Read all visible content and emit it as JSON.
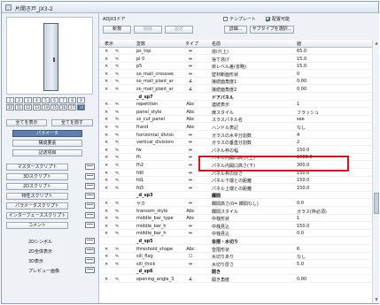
{
  "window": {
    "title": "片開き戸_JX3-2"
  },
  "left": {
    "view_rows": [
      [
        "1",
        "2",
        "3",
        "4",
        "5",
        "6",
        "7",
        "8",
        "9"
      ],
      [
        "10",
        "11",
        "12",
        "13",
        "14",
        "15",
        "16",
        "17",
        "18"
      ]
    ],
    "show_all": "全てを表示",
    "hide_all": "全てを隠す",
    "nav": [
      "パラメータ",
      "構成要素",
      "記述項目"
    ],
    "scripts": [
      "マスタースクリプト",
      "3Dスクリプト",
      "2Dスクリプト",
      "特性スクリプト",
      "パラメータスクリプト",
      "インターフェーススクリプト",
      "コメント"
    ],
    "views": [
      "2Dシンボル",
      "2D全体表示",
      "3D表示",
      "プレビュー画像"
    ]
  },
  "top": {
    "library_name": "ADJX3ドア",
    "template_label": "テンプレート",
    "placeable_label": "配置可能",
    "buttons": {
      "new": "新規",
      "delete": "削除",
      "settings": "設定",
      "details": "詳細...",
      "subtype": "サブタイプを選択..."
    }
  },
  "table": {
    "headers": {
      "show": "表示",
      "variable": "変数",
      "type": "タイプ",
      "name": "名前",
      "value": "値"
    },
    "rows": [
      {
        "var": "ps_top",
        "type": "⇹",
        "name": "逃げ(上)",
        "value": "65.0"
      },
      {
        "var": "pl 0",
        "type": "⇹",
        "name": "捨て逃げ",
        "value": "15.0"
      },
      {
        "var": "p5",
        "type": "⇹",
        "name": "床レベル差(省略)",
        "value": "15.0"
      },
      {
        "var": "so_mall_crosssection",
        "type": "⇹",
        "name": "壁材断面形状",
        "value": "0"
      },
      {
        "var": "so_mall_plant_angle1",
        "type": "∡",
        "name": "接続面角度1",
        "value": "0.00"
      },
      {
        "var": "so_mall_plant_angle2",
        "type": "∡",
        "name": "接続面角度2",
        "value": "0.00"
      },
      {
        "var": "_d_sp7",
        "type": "",
        "name": "ドアパネル",
        "value": "",
        "section": true
      },
      {
        "var": "repetition",
        "type": "Abc",
        "name": "連続表示",
        "value": "1"
      },
      {
        "var": "panel_style",
        "type": "Abc",
        "name": "扉スタイル",
        "value": "フラッシュ"
      },
      {
        "var": "ss_cut_panel",
        "type": "Abc",
        "name": "スラスパネル名",
        "value": "see"
      },
      {
        "var": "frand",
        "type": "Abc",
        "name": "ハンドル表記",
        "value": "なし"
      },
      {
        "var": "horizontal_divisions",
        "type": "⇹",
        "name": "ガラスの水平分割数",
        "value": "4"
      },
      {
        "var": "vertical_divisions",
        "type": "⇹",
        "name": "ガラスの垂直分割数",
        "value": "2"
      },
      {
        "var": "fw",
        "type": "⇹",
        "name": "パネル枠の幅",
        "value": "150.0"
      },
      {
        "var": "fh",
        "type": "⇹",
        "name": "パネル内開口高さ(上)",
        "value": "1000.0"
      },
      {
        "var": "fh2",
        "type": "⇹",
        "name": "パネル内開口高さ(下)",
        "value": "300.0"
      },
      {
        "var": "fd0",
        "type": "⇹",
        "name": "パネル枠の厚さ",
        "value": "150.0"
      },
      {
        "var": "fd1",
        "type": "⇹",
        "name": "パネル下端との距離",
        "value": "150.0"
      },
      {
        "var": "fd3",
        "type": "⇹",
        "name": "パネル上端との距離",
        "value": "150.0"
      },
      {
        "var": "_d_sp3",
        "type": "",
        "name": "欄間",
        "value": "",
        "section": true
      },
      {
        "var": "ヤカ",
        "type": "⇹",
        "name": "欄間高さ(0= 欄間なし)",
        "value": "0.0"
      },
      {
        "var": "transom_style",
        "type": "Abc",
        "name": "欄間スタイル",
        "value": "ガラス(枠必須)"
      },
      {
        "var": "middle_bar_type",
        "type": "Abc",
        "name": "中桟形状",
        "value": "1"
      },
      {
        "var": "middle_bar_h",
        "type": "⇹",
        "name": "中桟見込",
        "value": "150.0"
      },
      {
        "var": "middle_bar_h",
        "type": "⇹",
        "name": "中桟見込",
        "value": "0.0"
      },
      {
        "var": "_d_sp5",
        "type": "",
        "name": "沓摺・水切り",
        "value": "",
        "section": true
      },
      {
        "var": "threshold_shape",
        "type": "Abc",
        "name": "沓摺形状",
        "value": "6"
      },
      {
        "var": "sill_flag",
        "type": "☐",
        "name": "水切りあり",
        "value": "なし"
      },
      {
        "var": "sill_thick",
        "type": "⇹",
        "name": "水切り厚さ",
        "value": "5.0"
      },
      {
        "var": "_d_sp6",
        "type": "",
        "name": "開き",
        "value": "",
        "section": true
      },
      {
        "var": "opening_angle_3D",
        "type": "∡",
        "name": "開き角度",
        "value": "0.00"
      }
    ]
  }
}
